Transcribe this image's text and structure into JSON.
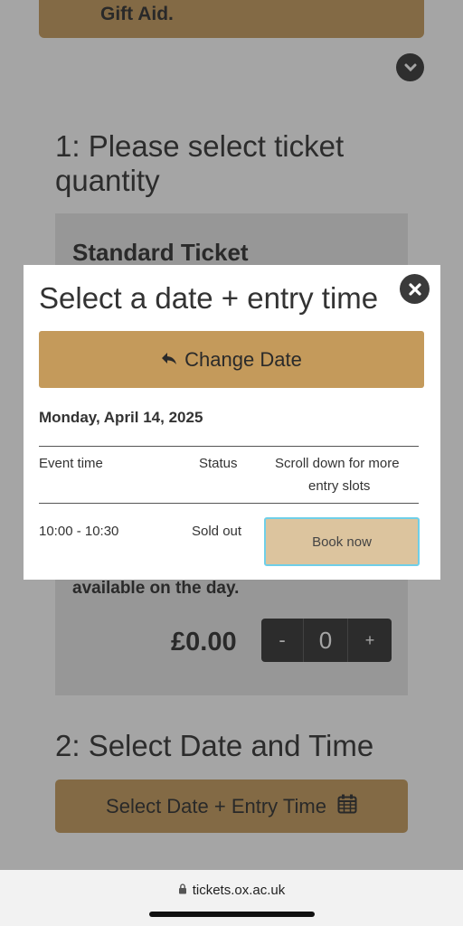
{
  "background": {
    "gift_aid_label": "Gift Aid.",
    "section1_title_line1": "1: Please select ticket",
    "section1_title_line2": "quantity",
    "ticket_title": "Standard Ticket",
    "availability_text": "available on the day.",
    "price": "£0.00",
    "stepper": {
      "minus": "-",
      "quantity": "0",
      "plus": "+"
    },
    "section2_title": "2: Select Date and Time",
    "select_date_button": "Select Date + Entry Time"
  },
  "modal": {
    "title": "Select a date + entry time",
    "change_date_button": "Change Date",
    "date": "Monday, April 14, 2025",
    "table": {
      "headers": {
        "event_time": "Event time",
        "status": "Status",
        "more_line1": "Scroll down for more",
        "more_line2": "entry slots"
      },
      "rows": [
        {
          "time": "10:00 - 10:30",
          "status": "Sold out",
          "action": "Book now"
        }
      ]
    }
  },
  "browser": {
    "url": "tickets.ox.ac.uk"
  },
  "colors": {
    "accent": "#c49a5b",
    "book_button": "#dcc49e",
    "focus_ring": "#6fcfe8"
  }
}
